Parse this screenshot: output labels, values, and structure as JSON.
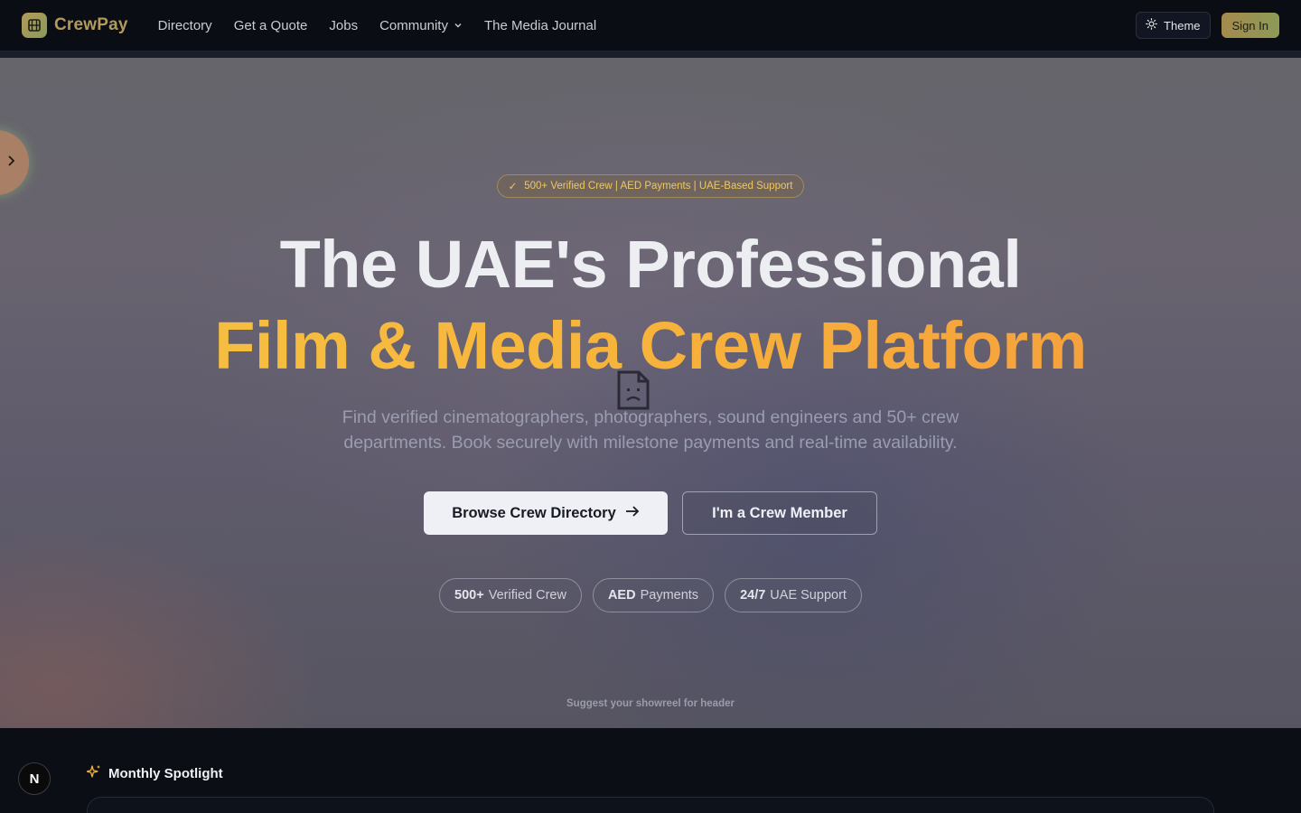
{
  "nav": {
    "brand": "CrewPay",
    "links": [
      {
        "label": "Directory"
      },
      {
        "label": "Get a Quote"
      },
      {
        "label": "Jobs"
      },
      {
        "label": "Community",
        "dropdown": true
      },
      {
        "label": "The Media Journal"
      }
    ],
    "theme_label": "Theme",
    "signin_label": "Sign In"
  },
  "hero": {
    "badge": "500+ Verified Crew | AED Payments | UAE-Based Support",
    "badge_icon": "check-icon",
    "title_line1": "The UAE's Professional",
    "title_line2": "Film & Media Crew Platform",
    "subtitle": "Find verified cinematographers, photographers, sound engineers and 50+ crew departments. Book securely with milestone payments and real-time availability.",
    "primary_cta": "Browse Crew Directory",
    "secondary_cta": "I'm a Crew Member",
    "stats": [
      {
        "value": "500+",
        "label": "Verified Crew"
      },
      {
        "value": "AED",
        "label": "Payments"
      },
      {
        "value": "24/7",
        "label": "UAE Support"
      }
    ],
    "suggest": "Suggest your showreel for header"
  },
  "spotlight": {
    "title": "Monthly Spotlight",
    "icon": "sparkles-icon"
  },
  "framework_badge": "N",
  "colors": {
    "brand": "#b29a5c",
    "accent_gold": "#f6c443",
    "accent_orange": "#f59a3c",
    "nav_bg": "#0a0d14"
  }
}
